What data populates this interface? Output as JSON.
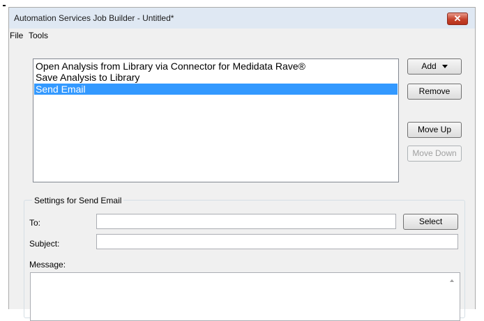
{
  "window": {
    "title": "Automation Services Job Builder - Untitled*",
    "close_label": "✕"
  },
  "menu": {
    "items": [
      "File",
      "Tools"
    ]
  },
  "task_list": {
    "items": [
      "Open Analysis from Library via Connector for Medidata Rave®",
      "Save Analysis to Library",
      "Send Email"
    ],
    "selected": "Send Email"
  },
  "buttons": {
    "add": "Add",
    "remove": "Remove",
    "move_up": "Move Up",
    "move_down": "Move Down",
    "select": "Select"
  },
  "settings": {
    "title": "Settings for Send Email",
    "to_label": "To:",
    "to_value": "",
    "subject_label": "Subject:",
    "subject_value": "",
    "message_label": "Message:",
    "message_value": ""
  },
  "colors": {
    "selection": "#3399ff",
    "close_button": "#c5422b",
    "window_bg": "#f0f0f0"
  }
}
